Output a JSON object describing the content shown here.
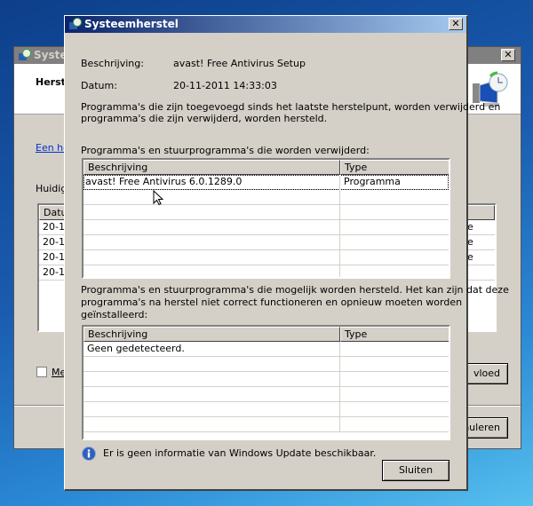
{
  "background_window": {
    "title": "Systeemherstel",
    "header": "Herstel",
    "link": "Een he",
    "current_label": "Huidige",
    "table_header": "Datum",
    "rows": [
      {
        "date": "20-1",
        "type": "date"
      },
      {
        "date": "20-1",
        "type": "date"
      },
      {
        "date": "20-1",
        "type": "date"
      },
      {
        "date": "20-1",
        "type": ""
      }
    ],
    "checkbox_label": "Me",
    "affected_button": "vloed",
    "cancel_button": "nuleren"
  },
  "dialog": {
    "title": "Systeemherstel",
    "description_label": "Beschrijving:",
    "description_value": "avast! Free Antivirus Setup",
    "date_label": "Datum:",
    "date_value": "20-11-2011 14:33:03",
    "intro_line1": "Programma's die zijn toegevoegd sinds het laatste herstelpunt, worden verwijderd en",
    "intro_line2": "programma's die zijn verwijderd, worden hersteld.",
    "removed_label": "Programma's en stuurprogramma's die worden verwijderd:",
    "removed_table": {
      "headers": [
        "Beschrijving",
        "Type"
      ],
      "rows": [
        {
          "description": "avast! Free Antivirus 6.0.1289.0",
          "type": "Programma"
        }
      ]
    },
    "restored_line1": "Programma's en stuurprogramma's die mogelijk worden hersteld. Het kan zijn dat deze",
    "restored_line2": "programma's na herstel niet correct functioneren en opnieuw moeten worden",
    "restored_line3": "geïnstalleerd:",
    "restored_table": {
      "headers": [
        "Beschrijving",
        "Type"
      ],
      "rows": [
        {
          "description": "Geen gedetecteerd.",
          "type": ""
        }
      ]
    },
    "info_text": "Er is geen informatie van Windows Update beschikbaar.",
    "close_button": "Sluiten"
  }
}
